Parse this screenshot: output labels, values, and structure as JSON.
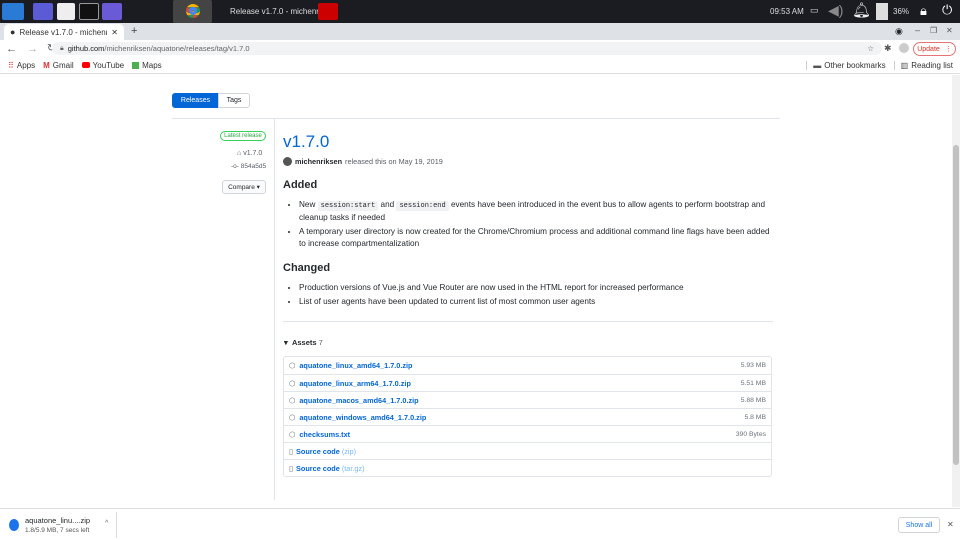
{
  "taskbar": {
    "window_title": "Release v1.7.0 - michenri...",
    "clock": "09:53 AM",
    "battery": "36%"
  },
  "browser": {
    "tab_title": "Release v1.7.0 - michenriksen",
    "new_tab": "+",
    "url_host": "github.com",
    "url_path": "/michenriksen/aquatone/releases/tag/v1.7.0",
    "update_label": "Update",
    "bookmarks": [
      {
        "label": "Apps",
        "icon": "apps-grid-icon"
      },
      {
        "label": "Gmail",
        "icon": "gmail-icon"
      },
      {
        "label": "YouTube",
        "icon": "youtube-icon"
      },
      {
        "label": "Maps",
        "icon": "maps-icon"
      }
    ],
    "other_bookmarks": "Other bookmarks",
    "reading_list": "Reading list"
  },
  "nav": {
    "releases": "Releases",
    "tags": "Tags"
  },
  "sidebar": {
    "badge": "Latest release",
    "tag": "v1.7.0",
    "commit": "854a5d5",
    "compare": "Compare"
  },
  "release": {
    "title": "v1.7.0",
    "author": "michenriksen",
    "released_text": "released this on May 19, 2019",
    "added_heading": "Added",
    "added": {
      "i1_a": "New ",
      "i1_code1": "session:start",
      "i1_b": " and ",
      "i1_code2": "session:end",
      "i1_c": " events have been introduced in the event bus to allow agents to perform bootstrap and cleanup tasks if needed",
      "i2": "A temporary user directory is now created for the Chrome/Chromium process and additional command line flags have been added to increase compartmentalization"
    },
    "changed_heading": "Changed",
    "changed": [
      "Production versions of Vue.js and Vue Router are now used in the HTML report for increased performance",
      "List of user agents have been updated to current list of most common user agents"
    ],
    "assets_label": "Assets",
    "assets_count": "7",
    "assets": [
      {
        "name": "aquatone_linux_amd64_1.7.0.zip",
        "size": "5.93 MB"
      },
      {
        "name": "aquatone_linux_arm64_1.7.0.zip",
        "size": "5.51 MB"
      },
      {
        "name": "aquatone_macos_amd64_1.7.0.zip",
        "size": "5.88 MB"
      },
      {
        "name": "aquatone_windows_amd64_1.7.0.zip",
        "size": "5.8 MB"
      },
      {
        "name": "checksums.txt",
        "size": "390 Bytes"
      }
    ],
    "sources": [
      {
        "label": "Source code",
        "fmt": "(zip)"
      },
      {
        "label": "Source code",
        "fmt": "(tar.gz)"
      }
    ]
  },
  "download": {
    "file": "aquatone_linu....zip",
    "status": "1.8/5.9 MB, 7 secs left",
    "show_all": "Show all"
  }
}
